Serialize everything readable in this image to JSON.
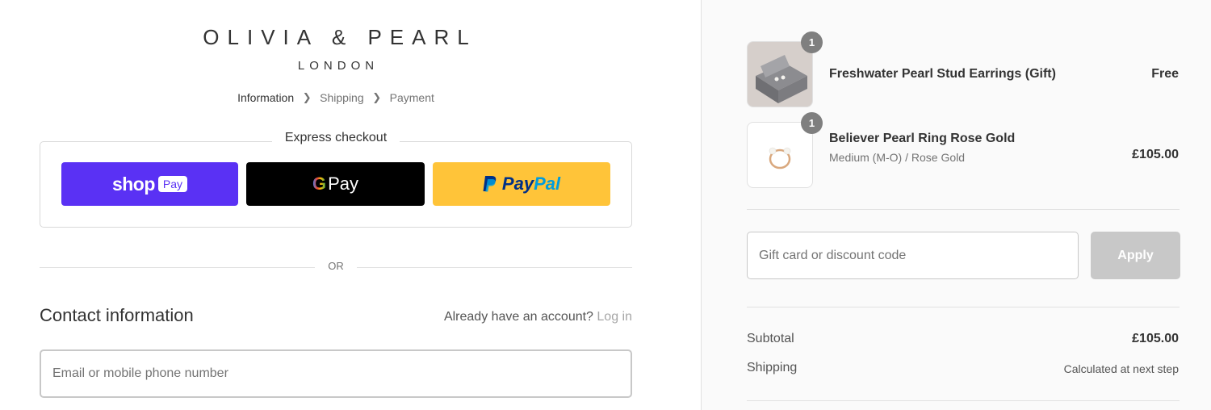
{
  "brand": {
    "name": "OLIVIA & PEARL",
    "location": "LONDON"
  },
  "breadcrumb": {
    "items": [
      "Information",
      "Shipping",
      "Payment"
    ],
    "active": "Information"
  },
  "express": {
    "title": "Express checkout",
    "shop_pay": {
      "logo": "shop",
      "tag": "Pay"
    },
    "google_pay": {
      "g": "G",
      "label": "Pay"
    },
    "paypal": {
      "pay": "Pay",
      "pal": "Pal"
    }
  },
  "divider_text": "OR",
  "contact": {
    "title": "Contact information",
    "account_prompt": "Already have an account?",
    "login_label": "Log in",
    "email_placeholder": "Email or mobile phone number"
  },
  "cart": {
    "items": [
      {
        "quantity": "1",
        "name": "Freshwater Pearl Stud Earrings (Gift)",
        "variant": "",
        "price": "Free"
      },
      {
        "quantity": "1",
        "name": "Believer Pearl Ring Rose Gold",
        "variant": "Medium (M-O) / Rose Gold",
        "price": "£105.00"
      }
    ]
  },
  "discount": {
    "placeholder": "Gift card or discount code",
    "apply_label": "Apply"
  },
  "summary": {
    "subtotal_label": "Subtotal",
    "subtotal_value": "£105.00",
    "shipping_label": "Shipping",
    "shipping_value": "Calculated at next step"
  },
  "colors": {
    "shop_pay": "#5a31f4",
    "google_pay": "#000000",
    "paypal": "#ffc439",
    "badge": "#7f7f7f",
    "apply_disabled": "#c8c8c8"
  }
}
